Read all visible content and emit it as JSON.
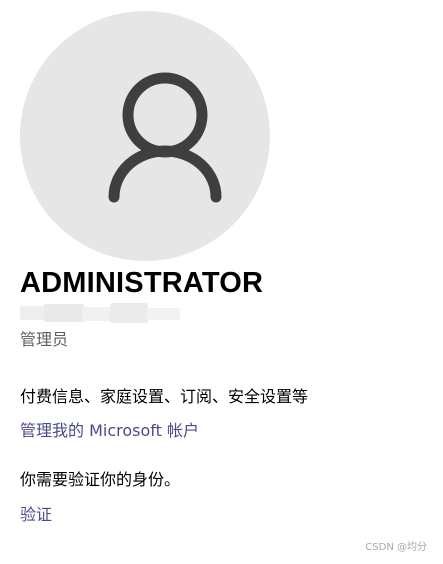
{
  "account": {
    "avatar_icon": "person-icon",
    "username": "ADMINISTRATOR",
    "role": "管理员"
  },
  "settings": {
    "description": "付费信息、家庭设置、订阅、安全设置等",
    "manage_link": "管理我的 Microsoft 帐户"
  },
  "verification": {
    "prompt": "你需要验证你的身份。",
    "verify_link": "验证"
  },
  "watermark": "CSDN @均分",
  "colors": {
    "avatar_background": "#e6e6e6",
    "avatar_icon": "#3f3f3f",
    "link": "#4b4b8a",
    "secondary_text": "#5f5f5f"
  }
}
